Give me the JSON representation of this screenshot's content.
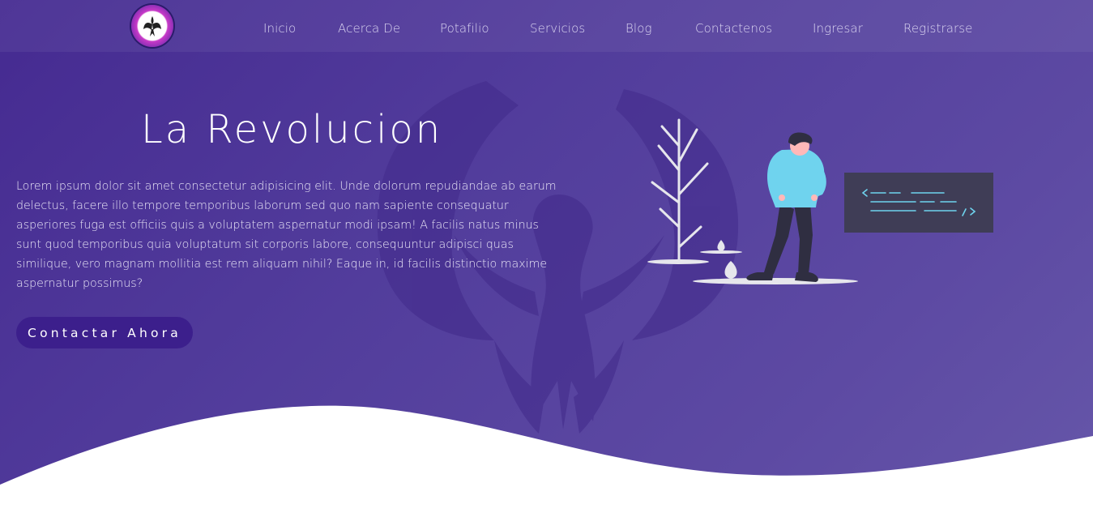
{
  "nav": {
    "logo_alt": "phoenix-logo",
    "items": [
      {
        "label": "Inicio"
      },
      {
        "label": "Acerca De"
      },
      {
        "label": "Potafilio"
      },
      {
        "label": "Servicios"
      },
      {
        "label": "Blog"
      },
      {
        "label": "Contactenos"
      },
      {
        "label": "Ingresar"
      },
      {
        "label": "Registrarse"
      }
    ]
  },
  "hero": {
    "title": "La Revolucion",
    "paragraph": "Lorem ipsum dolor sit amet consectetur adipisicing elit. Unde dolorum repudiandae ab earum delectus, facere illo tempore temporibus laborum sed quo nam sapiente consequatur asperiores fuga est officiis quis a voluptatem aspernatur modi ipsam! A facilis natus minus sunt quod temporibus quia voluptatum sit corporis labore, consequuntur adipisci quas similique, vero magnam mollitia est rem aliquam nihil? Eaque in, id facilis distinctio maxime aspernatur possimus?",
    "cta_label": "Contactar Ahora"
  },
  "colors": {
    "hero_start": "#452a91",
    "hero_end": "#6657a9",
    "cta_bg": "#3c1f8c",
    "accent_cyan": "#6fd3ee",
    "code_panel": "#3f3d56"
  },
  "icons": {
    "logo": "phoenix-icon",
    "background": "phoenix-watermark-icon",
    "illustration": "developer-illustration"
  }
}
